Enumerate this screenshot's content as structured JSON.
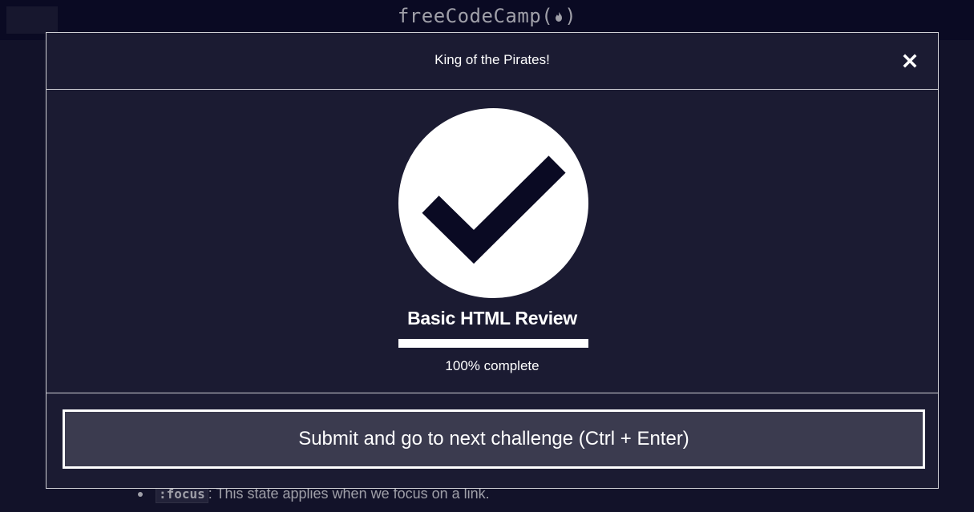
{
  "background": {
    "brand": "freeCodeCamp(",
    "brand_close": ")",
    "list_item_code": ":focus",
    "list_item_text": ": This state applies when we focus on a link."
  },
  "modal": {
    "title": "King of the Pirates!",
    "close_icon": "close-icon",
    "check_icon": "checkmark-circle-icon",
    "block_title": "Basic HTML Review",
    "progress_percent": 100,
    "progress_text": "100% complete",
    "submit_label": "Submit and go to next challenge (Ctrl + Enter)"
  },
  "colors": {
    "page_bg": "#0a0a23",
    "modal_bg": "#1b1b32",
    "button_bg": "#3b3b4f",
    "foreground": "#ffffff"
  }
}
